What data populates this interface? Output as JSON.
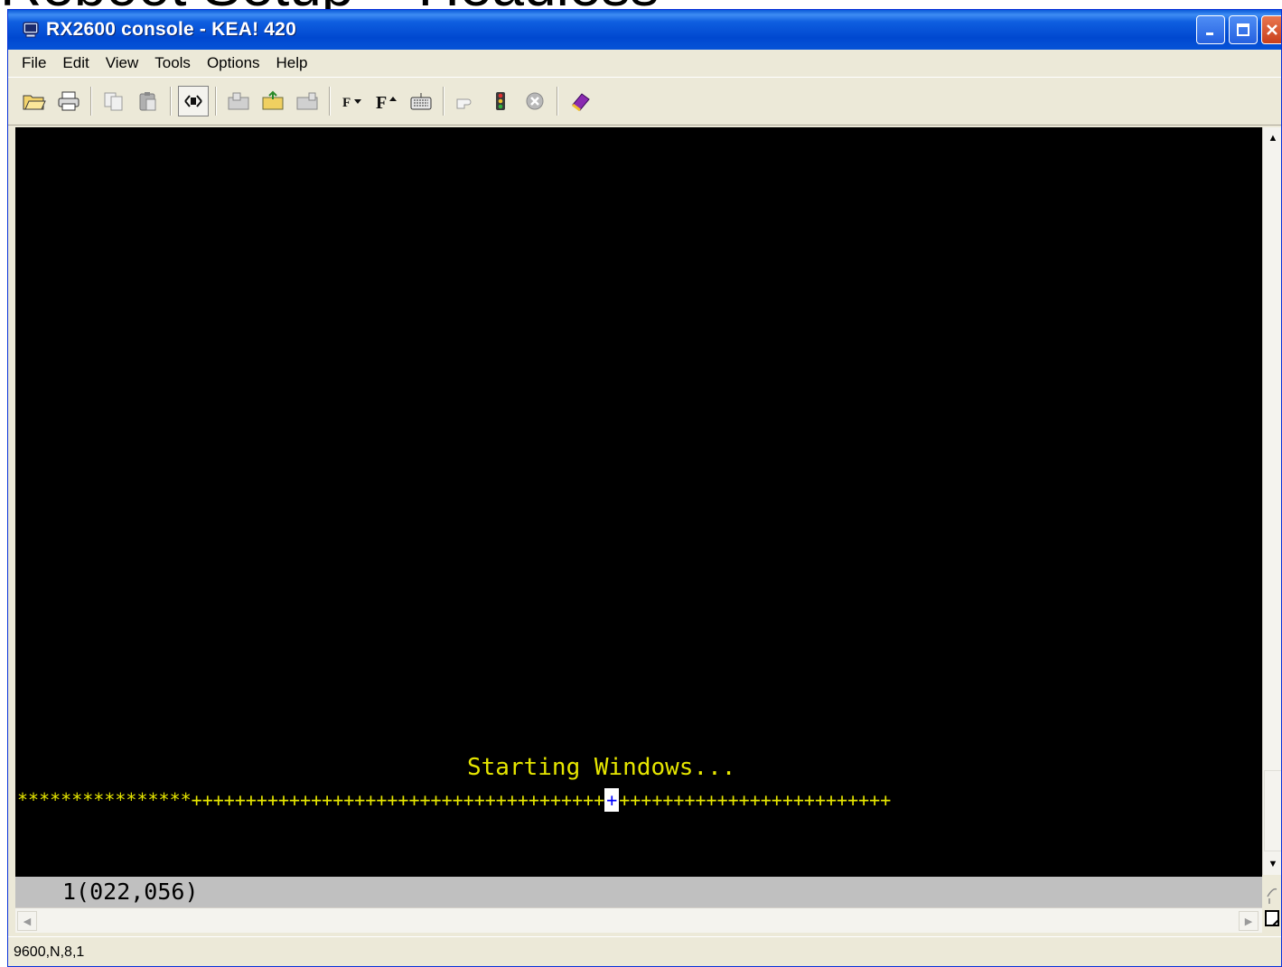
{
  "slide": {
    "title_fragment": "Reboot Setup – Headless"
  },
  "window": {
    "title": "RX2600 console - KEA! 420",
    "title_bar_color": "#0054e3",
    "buttons": {
      "minimize": "minimize",
      "maximize": "maximize",
      "close": "close"
    }
  },
  "menu": {
    "items": [
      {
        "label": "File"
      },
      {
        "label": "Edit"
      },
      {
        "label": "View"
      },
      {
        "label": "Tools"
      },
      {
        "label": "Options"
      },
      {
        "label": "Help"
      }
    ]
  },
  "toolbar": {
    "buttons": [
      {
        "icon": "open-folder-icon"
      },
      {
        "icon": "print-icon"
      },
      {
        "icon": "copy-icon"
      },
      {
        "icon": "paste-icon"
      },
      {
        "icon": "connect-icon"
      },
      {
        "icon": "send-file-icon"
      },
      {
        "icon": "receive-file-icon"
      },
      {
        "icon": "capture-icon"
      },
      {
        "icon": "font-smaller-icon"
      },
      {
        "icon": "font-larger-icon"
      },
      {
        "icon": "keyboard-icon"
      },
      {
        "icon": "pointer-icon"
      },
      {
        "icon": "traffic-light-icon"
      },
      {
        "icon": "stop-icon"
      },
      {
        "icon": "help-book-icon"
      }
    ]
  },
  "terminal": {
    "background": "#000000",
    "text_color": "#e6e600",
    "message": "Starting Windows...",
    "progress": {
      "done_marks": "****************",
      "remaining_left": "++++++++++++++++++++++++++++++++++++++",
      "cursor_char": "+",
      "remaining_right": "+++++++++++++++++++++++++"
    }
  },
  "status": {
    "cursor_position": "1(022,056)",
    "connection": "9600,N,8,1"
  }
}
